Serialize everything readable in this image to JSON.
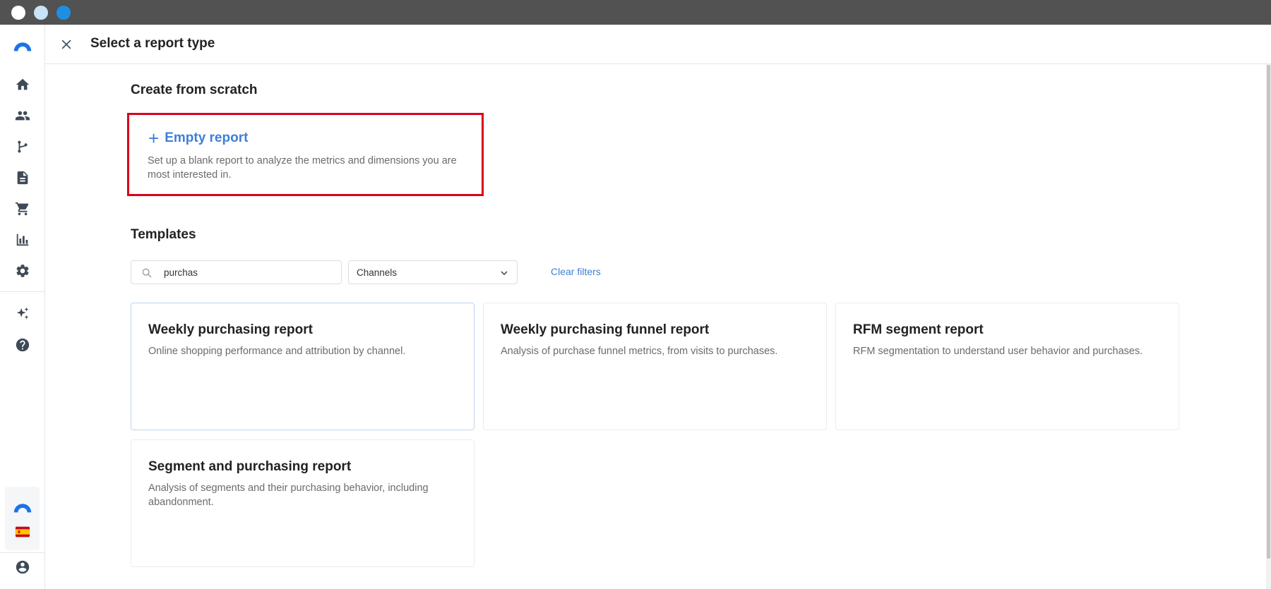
{
  "header": {
    "title": "Select a report type"
  },
  "sidebar": {
    "items": [
      {
        "name": "home-icon"
      },
      {
        "name": "users-icon"
      },
      {
        "name": "branch-icon"
      },
      {
        "name": "document-icon"
      },
      {
        "name": "cart-icon"
      },
      {
        "name": "bar-chart-icon"
      },
      {
        "name": "gear-icon"
      },
      {
        "name": "sparkles-icon"
      },
      {
        "name": "help-icon"
      }
    ],
    "bottom": [
      {
        "name": "brand-logo-icon"
      },
      {
        "name": "spain-flag-icon"
      },
      {
        "name": "user-account-icon"
      }
    ]
  },
  "scratch": {
    "section_title": "Create from scratch",
    "empty_report": {
      "title": "Empty report",
      "description": "Set up a blank report to analyze the metrics and dimensions you are most interested in."
    }
  },
  "templates": {
    "section_title": "Templates",
    "search": {
      "value": "purchas",
      "placeholder": ""
    },
    "channel_filter": {
      "selected": "Channels"
    },
    "clear_filters_label": "Clear filters",
    "cards": [
      {
        "title": "Weekly purchasing report",
        "description": "Online shopping performance and attribution by channel."
      },
      {
        "title": "Weekly purchasing funnel report",
        "description": "Analysis of purchase funnel metrics, from visits to purchases."
      },
      {
        "title": "RFM segment report",
        "description": "RFM segmentation to understand user behavior and purchases."
      },
      {
        "title": "Segment and purchasing report",
        "description": "Analysis of segments and their purchasing behavior, including abandonment."
      }
    ]
  },
  "colors": {
    "accent": "#3f7fd6",
    "highlight_border": "#d9001b",
    "titlebar": "#525252",
    "icon": "#3e4a57"
  }
}
